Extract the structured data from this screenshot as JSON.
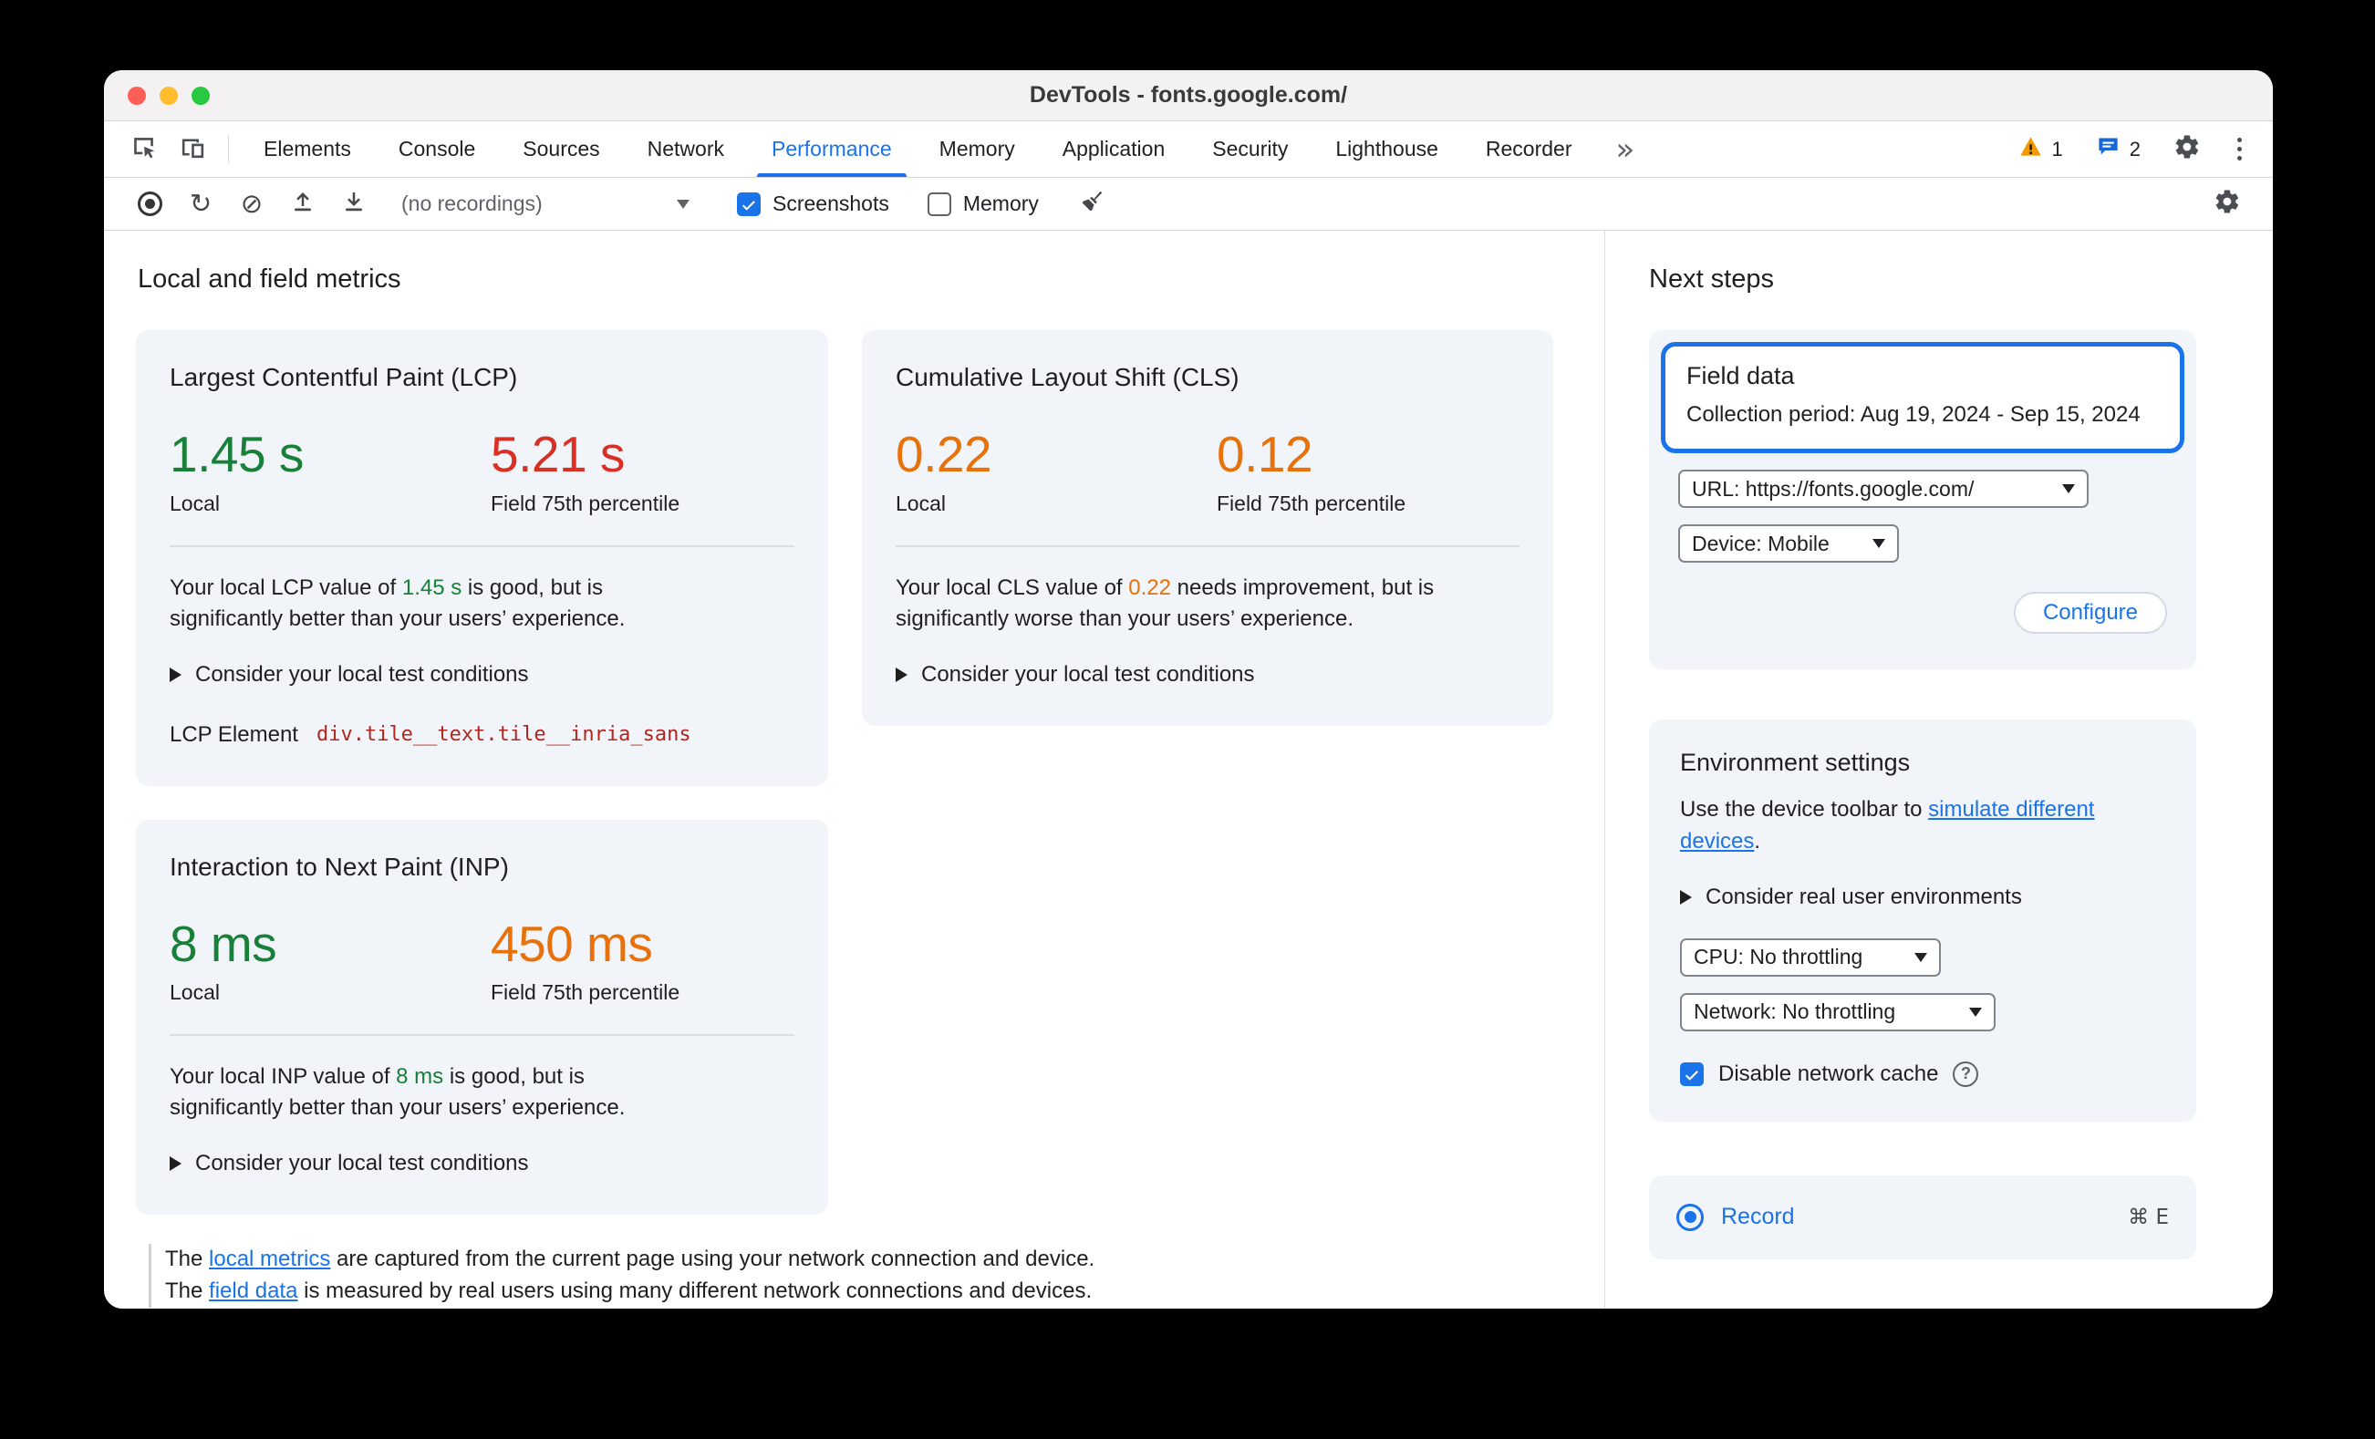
{
  "colors": {
    "accent": "#1a73e8",
    "good": "#188038",
    "poor": "#d93025",
    "needs_improvement": "#e8710a",
    "highlight_ring": "#1a73e8"
  },
  "window": {
    "title": "DevTools - fonts.google.com/"
  },
  "tabbar": {
    "tabs": [
      {
        "label": "Elements"
      },
      {
        "label": "Console"
      },
      {
        "label": "Sources"
      },
      {
        "label": "Network"
      },
      {
        "label": "Performance"
      },
      {
        "label": "Memory"
      },
      {
        "label": "Application"
      },
      {
        "label": "Security"
      },
      {
        "label": "Lighthouse"
      },
      {
        "label": "Recorder"
      }
    ],
    "selected_tab": "Performance",
    "warning_count": "1",
    "issues_count": "2"
  },
  "toolbar": {
    "recordings_select": "(no recordings)",
    "screenshots_label": "Screenshots",
    "memory_label": "Memory"
  },
  "icons": {
    "reload": "↻",
    "clear": "⊘",
    "more_tabs": "»",
    "help": "?"
  },
  "main": {
    "heading": "Local and field metrics",
    "lcp": {
      "title": "Largest Contentful Paint (LCP)",
      "local_value": "1.45 s",
      "local_label": "Local",
      "field_value": "5.21 s",
      "field_label": "Field 75th percentile",
      "desc_prefix": "Your local LCP value of ",
      "desc_value": "1.45 s",
      "desc_suffix": " is good, but is significantly better than your users’ experience.",
      "disclosure": "Consider your local test conditions",
      "element_label": "LCP Element",
      "element_value": "div.tile__text.tile__inria_sans"
    },
    "cls": {
      "title": "Cumulative Layout Shift (CLS)",
      "local_value": "0.22",
      "local_label": "Local",
      "field_value": "0.12",
      "field_label": "Field 75th percentile",
      "desc_prefix": "Your local CLS value of ",
      "desc_value": "0.22",
      "desc_suffix": " needs improvement, but is significantly worse than your users’ experience.",
      "disclosure": "Consider your local test conditions"
    },
    "inp": {
      "title": "Interaction to Next Paint (INP)",
      "local_value": "8 ms",
      "local_label": "Local",
      "field_value": "450 ms",
      "field_label": "Field 75th percentile",
      "desc_prefix": "Your local INP value of ",
      "desc_value": "8 ms",
      "desc_suffix": " is good, but is significantly better than your users’ experience.",
      "disclosure": "Consider your local test conditions"
    },
    "footer": {
      "line1_prefix": "The ",
      "line1_link": "local metrics",
      "line1_suffix": " are captured from the current page using your network connection and device.",
      "line2_prefix": "The ",
      "line2_link": "field data",
      "line2_suffix": " is measured by real users using many different network connections and devices."
    }
  },
  "sidebar": {
    "heading": "Next steps",
    "field_data": {
      "title": "Field data",
      "period": "Collection period: Aug 19, 2024 - Sep 15, 2024",
      "url_select": "URL: https://fonts.google.com/",
      "device_select": "Device: Mobile",
      "configure_label": "Configure"
    },
    "environment": {
      "title": "Environment settings",
      "text_prefix": "Use the device toolbar to ",
      "text_link": "simulate different devices",
      "text_suffix": ".",
      "disclosure": "Consider real user environments",
      "cpu_select": "CPU: No throttling",
      "network_select": "Network: No throttling",
      "cache_label": "Disable network cache"
    },
    "record": {
      "label": "Record",
      "shortcut": "⌘ E"
    }
  }
}
